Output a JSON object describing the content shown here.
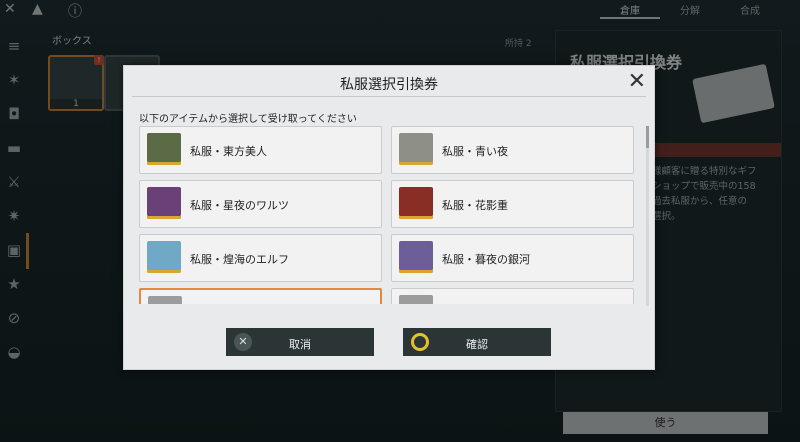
{
  "topbar": {
    "tabs": [
      "倉庫",
      "分解",
      "合成"
    ]
  },
  "inventory": {
    "section_title": "ボックス",
    "held_count": "所持 2",
    "slot_count": "1"
  },
  "detail": {
    "title": "私服選択引換券",
    "desc_lines": [
      "様顧客に贈る特別なギフ",
      "ショップで販売中の158",
      "過去私服から、任意の",
      "選択。"
    ],
    "use_button": "使う"
  },
  "modal": {
    "title": "私服選択引換券",
    "subtitle": "以下のアイテムから選択して受け取ってください",
    "items": [
      {
        "label": "私服・東方美人",
        "thumb_color": "#5a6b45"
      },
      {
        "label": "私服・青い夜",
        "thumb_color": "#8e8f86"
      },
      {
        "label": "私服・星夜のワルツ",
        "thumb_color": "#6b3f78"
      },
      {
        "label": "私服・花影重",
        "thumb_color": "#8a2d24"
      },
      {
        "label": "私服・煌海のエルフ",
        "thumb_color": "#6fa9c6"
      },
      {
        "label": "私服・暮夜の銀河",
        "thumb_color": "#6d5d98"
      }
    ],
    "cancel_label": "取消",
    "confirm_label": "確認"
  },
  "colors": {
    "accent": "#e28a43",
    "button_bg": "#2c3536",
    "confirm_ring": "#e0c22e"
  }
}
